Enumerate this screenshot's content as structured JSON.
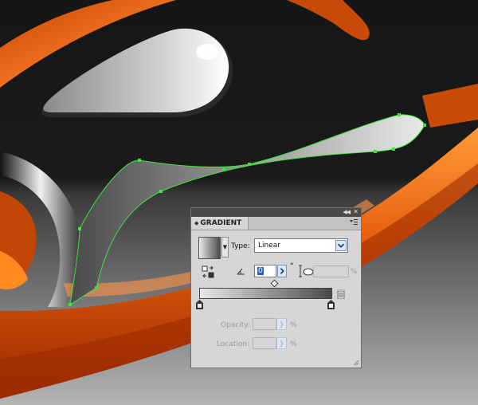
{
  "panel": {
    "title": "GRADIENT",
    "type_label": "Type:",
    "type_value": "Linear",
    "angle_value": "0",
    "degree_symbol": "°",
    "aspect_value": "",
    "aspect_unit": "%",
    "opacity_label": "Opacity:",
    "opacity_value": "",
    "opacity_unit": "%",
    "location_label": "Location:",
    "location_value": "",
    "location_unit": "%",
    "gradient_start_color": "#e9e9e9",
    "gradient_end_color": "#4a4a4a"
  },
  "artwork": {
    "background_color": "#161616",
    "ribbon_color": "#e05a10",
    "selection_color": "#3ce63c"
  },
  "icons": {
    "collapse": "double-chevron-icon",
    "close": "close-icon",
    "menu": "panel-menu-icon",
    "reverse": "reverse-gradient-icon",
    "angle": "angle-icon",
    "aspect": "aspect-ratio-icon",
    "delete": "trash-icon"
  }
}
